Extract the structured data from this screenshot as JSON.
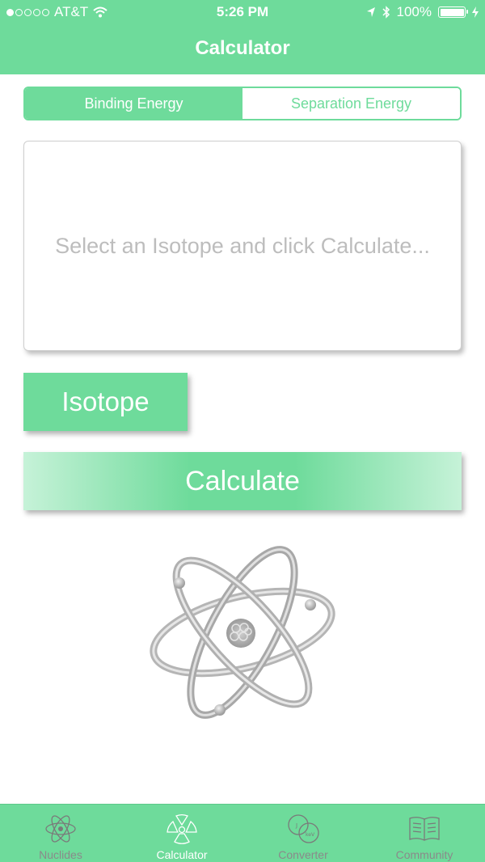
{
  "status_bar": {
    "carrier": "AT&T",
    "time": "5:26 PM",
    "battery": "100%",
    "signal_bars_filled": 1,
    "signal_bars_total": 5
  },
  "nav": {
    "title": "Calculator"
  },
  "segment": {
    "options": [
      "Binding Energy",
      "Separation Energy"
    ],
    "selected": "Binding Energy"
  },
  "result": {
    "placeholder": "Select an Isotope and click Calculate..."
  },
  "buttons": {
    "isotope": "Isotope",
    "calculate": "Calculate"
  },
  "tabs": [
    {
      "label": "Nuclides",
      "icon": "atom-icon"
    },
    {
      "label": "Calculator",
      "icon": "radiation-icon"
    },
    {
      "label": "Converter",
      "icon": "converter-icon"
    },
    {
      "label": "Community",
      "icon": "book-icon"
    }
  ],
  "active_tab": "Calculator",
  "colors": {
    "accent": "#6edb9b",
    "placeholder": "#bdbdbd",
    "inactive_tab": "#8a8a8a"
  }
}
